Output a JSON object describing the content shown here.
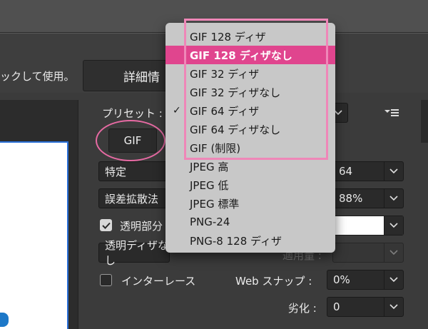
{
  "hint_text": "ックして使用。",
  "detail_button": "詳細情",
  "preset_label": "プリセット :",
  "format_button": "GIF",
  "dropdown": {
    "items": [
      {
        "label": "GIF 128 ディザ",
        "checked": false,
        "highlighted": false
      },
      {
        "label": "GIF 128 ディザなし",
        "checked": false,
        "highlighted": true
      },
      {
        "label": "GIF 32 ディザ",
        "checked": false,
        "highlighted": false
      },
      {
        "label": "GIF 32 ディザなし",
        "checked": false,
        "highlighted": false
      },
      {
        "label": "GIF 64 ディザ",
        "checked": true,
        "highlighted": false
      },
      {
        "label": "GIF 64 ディザなし",
        "checked": false,
        "highlighted": false
      },
      {
        "label": "GIF (制限)",
        "checked": false,
        "highlighted": false
      },
      {
        "label": "JPEG 高",
        "checked": false,
        "highlighted": false
      },
      {
        "label": "JPEG 低",
        "checked": false,
        "highlighted": false
      },
      {
        "label": "JPEG 標準",
        "checked": false,
        "highlighted": false
      },
      {
        "label": "PNG-24",
        "checked": false,
        "highlighted": false
      },
      {
        "label": "PNG-8 128 ディザ",
        "checked": false,
        "highlighted": false
      }
    ],
    "check_mark": "✓",
    "highlight_color": "#e0458e"
  },
  "settings": {
    "palette_value": "特定",
    "colors_value": "64",
    "dither_value": "誤差拡散法",
    "dither_amount": "88%",
    "transparency_label": "透明部分",
    "transparency_checked": true,
    "matte_value": "",
    "transparency_dither_value": "透明ディザなし",
    "amount_label": "適用量 :",
    "interlace_label": "インターレース",
    "interlace_checked": false,
    "web_snap_label": "Web スナップ :",
    "web_snap_value": "0%",
    "lossy_label": "劣化 :",
    "lossy_value": "0"
  },
  "colors": {
    "annotation_pink": "#ef87b8"
  }
}
